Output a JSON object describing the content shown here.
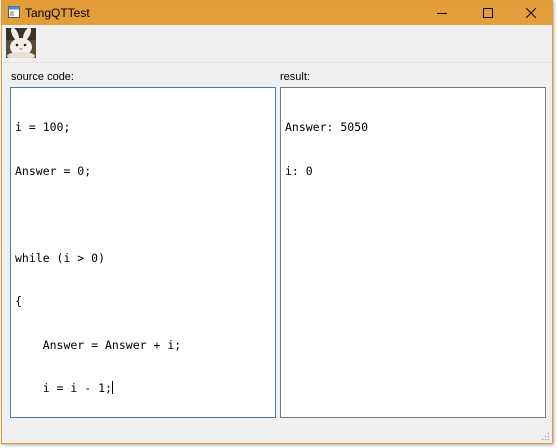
{
  "window": {
    "title": "TangQTTest",
    "controls": {
      "minimize_icon": "minimize-icon",
      "maximize_icon": "maximize-icon",
      "close_icon": "close-icon"
    }
  },
  "toolbar": {
    "run_button_icon": "rabbit-icon"
  },
  "source_panel": {
    "label": "source code:",
    "lines": [
      "i = 100;",
      "Answer = 0;",
      "",
      "while (i > 0)",
      "{",
      "    Answer = Answer + i;",
      "    i = i - 1;",
      "}"
    ]
  },
  "result_panel": {
    "label": "result:",
    "lines": [
      "Answer: 5050",
      "i: 0"
    ]
  },
  "colors": {
    "titlebar": "#e49d3b",
    "window_background": "#f0f0f0",
    "focused_border": "#3c7fb1"
  }
}
